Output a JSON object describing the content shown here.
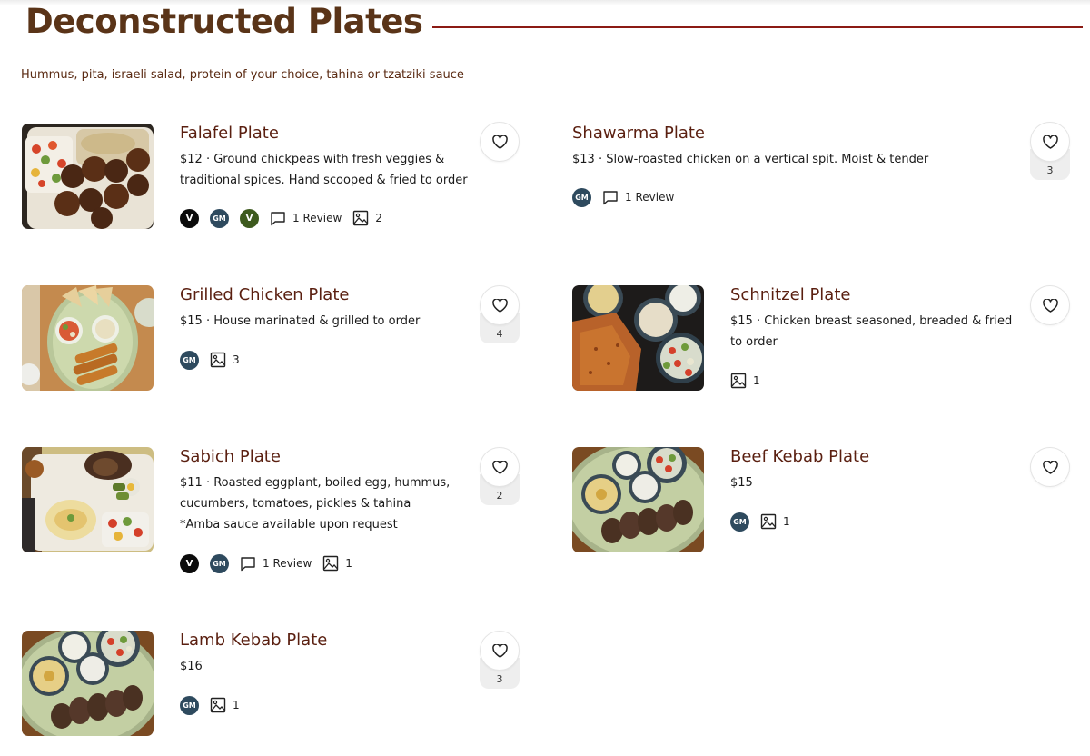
{
  "section": {
    "title": "Deconstructed Plates",
    "description": "Hummus, pita, israeli salad, protein of your choice, tahina or tzatziki sauce"
  },
  "badges": {
    "vegetarian": "V",
    "gluten_minded": "GM",
    "vegan": "V"
  },
  "colors": {
    "title": "#5a3418",
    "rule": "#8b1a14",
    "item_name": "#5a1f10",
    "gm_badge": "#2e4a5e",
    "vegan_badge": "#3d5a1e"
  },
  "items": [
    {
      "name": "Falafel Plate",
      "price": "$12",
      "desc_lines": [
        "Ground chickpeas with fresh veggies &",
        "traditional spices. Hand scooped & fried to order"
      ],
      "reviews": "1 Review",
      "photos": "2",
      "likes": "",
      "icons": [
        "vegetarian-badge",
        "gluten-minded-badge",
        "vegan-badge",
        "review-icon",
        "image-icon",
        "heart-icon"
      ]
    },
    {
      "name": "Shawarma Plate",
      "price": "$13",
      "desc_lines": [
        "Slow-roasted chicken on a vertical spit. Moist & tender"
      ],
      "reviews": "1 Review",
      "likes": "3"
    },
    {
      "name": "Grilled Chicken Plate",
      "price": "$15",
      "desc_lines": [
        "House marinated & grilled to order"
      ],
      "photos": "3",
      "likes": "4"
    },
    {
      "name": "Schnitzel Plate",
      "price": "$15",
      "desc_lines": [
        "Chicken breast seasoned, breaded & fried",
        "to order"
      ],
      "photos": "1",
      "likes": ""
    },
    {
      "name": "Sabich Plate",
      "price": "$11",
      "desc_lines": [
        "Roasted eggplant, boiled egg, hummus,",
        "cucumbers, tomatoes, pickles & tahina",
        "*Amba sauce available upon request"
      ],
      "reviews": "1 Review",
      "photos": "1",
      "likes": "2"
    },
    {
      "name": "Beef Kebab Plate",
      "price": "$15",
      "photos": "1",
      "likes": ""
    },
    {
      "name": "Lamb Kebab Plate",
      "price": "$16",
      "photos": "1",
      "likes": "3"
    }
  ],
  "price_separator": " · "
}
